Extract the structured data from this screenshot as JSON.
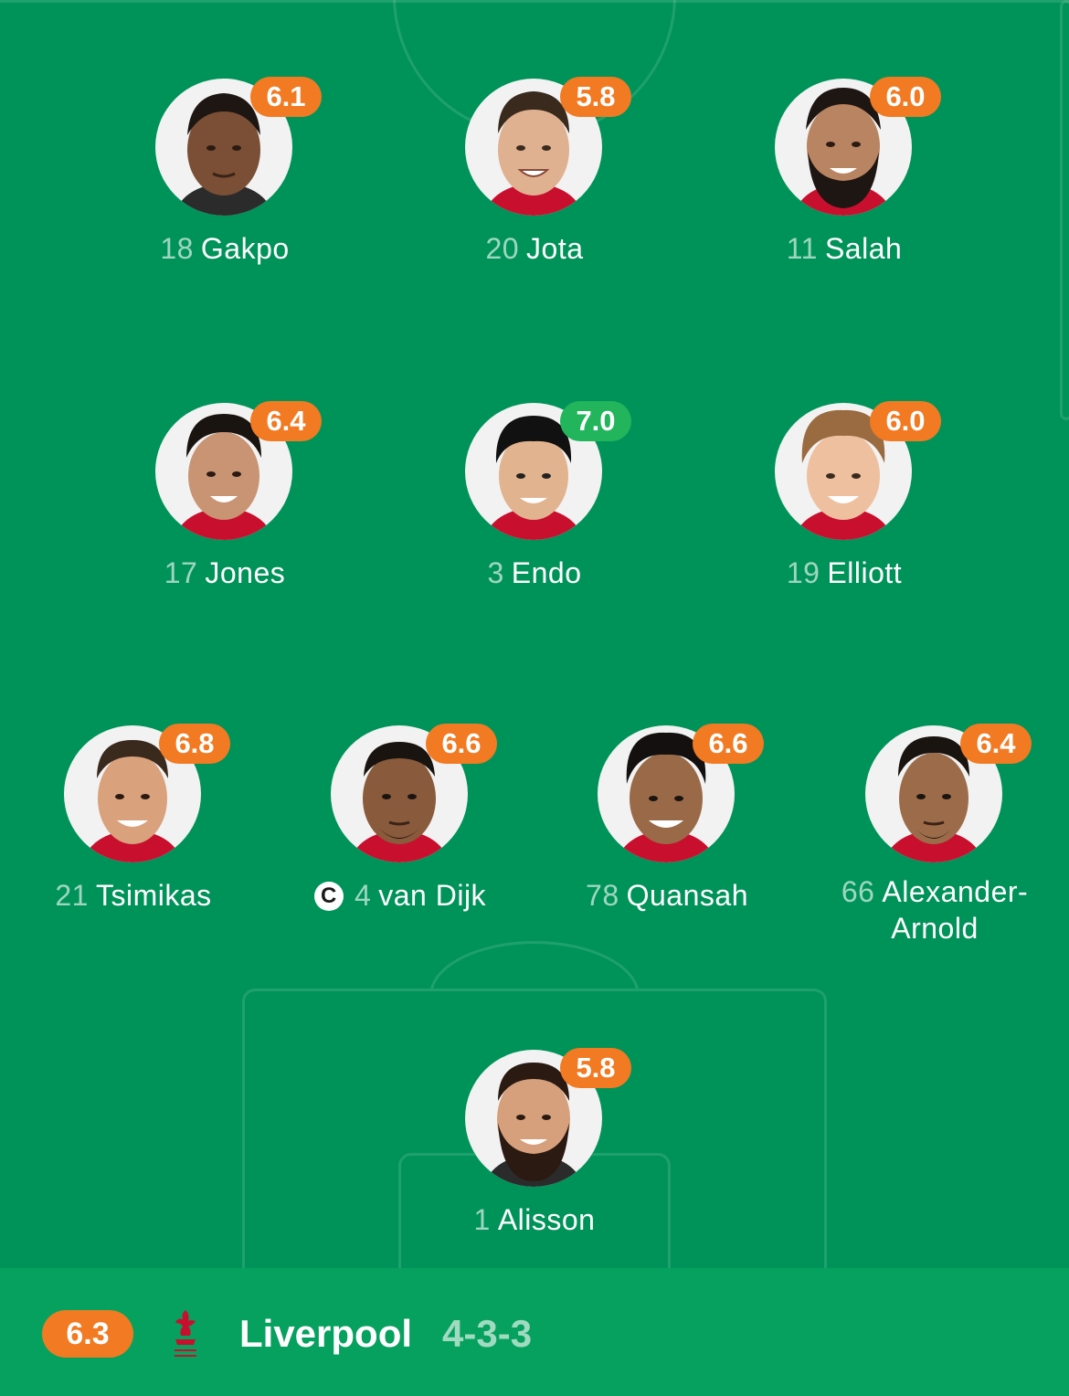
{
  "team": {
    "name": "Liverpool",
    "formation": "4-3-3",
    "rating": "6.3",
    "rating_color": "#f27a22"
  },
  "colors": {
    "pitch": "#009359",
    "footer": "#06a15e",
    "rating_orange": "#f27a22",
    "rating_green": "#22b55c",
    "crest": "#c8102e"
  },
  "players": {
    "gakpo": {
      "number": "18",
      "name": "Gakpo",
      "rating": "6.1",
      "rating_color": "#f27a22"
    },
    "jota": {
      "number": "20",
      "name": "Jota",
      "rating": "5.8",
      "rating_color": "#f27a22"
    },
    "salah": {
      "number": "11",
      "name": "Salah",
      "rating": "6.0",
      "rating_color": "#f27a22"
    },
    "jones": {
      "number": "17",
      "name": "Jones",
      "rating": "6.4",
      "rating_color": "#f27a22"
    },
    "endo": {
      "number": "3",
      "name": "Endo",
      "rating": "7.0",
      "rating_color": "#22b55c"
    },
    "elliott": {
      "number": "19",
      "name": "Elliott",
      "rating": "6.0",
      "rating_color": "#f27a22"
    },
    "tsimikas": {
      "number": "21",
      "name": "Tsimikas",
      "rating": "6.8",
      "rating_color": "#f27a22"
    },
    "vandijk": {
      "number": "4",
      "name": "van Dijk",
      "rating": "6.6",
      "rating_color": "#f27a22",
      "captain_mark": "C"
    },
    "quansah": {
      "number": "78",
      "name": "Quansah",
      "rating": "6.6",
      "rating_color": "#f27a22"
    },
    "alexander": {
      "number": "66",
      "name": "Alexander-",
      "name_line2": "Arnold",
      "rating": "6.4",
      "rating_color": "#f27a22"
    },
    "alisson": {
      "number": "1",
      "name": "Alisson",
      "rating": "5.8",
      "rating_color": "#f27a22"
    }
  }
}
